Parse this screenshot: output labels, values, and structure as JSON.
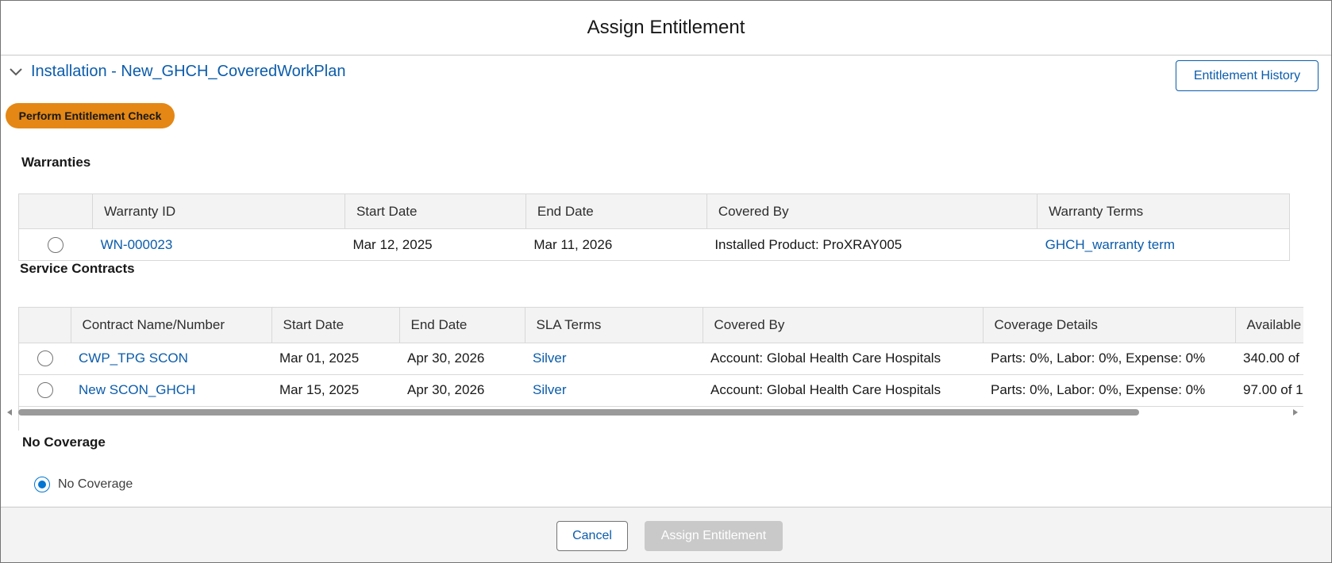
{
  "modal": {
    "title": "Assign Entitlement"
  },
  "installation": {
    "label": "Installation - New_GHCH_CoveredWorkPlan"
  },
  "buttons": {
    "entitlement_history": "Entitlement History",
    "perform_check": "Perform Entitlement Check",
    "cancel": "Cancel",
    "assign": "Assign Entitlement"
  },
  "warranties": {
    "title": "Warranties",
    "columns": [
      "",
      "Warranty ID",
      "Start Date",
      "End Date",
      "Covered By",
      "Warranty Terms"
    ],
    "rows": [
      {
        "id": "WN-000023",
        "start": "Mar 12, 2025",
        "end": "Mar 11, 2026",
        "covered_by": "Installed Product: ProXRAY005",
        "terms": "GHCH_warranty term",
        "selected": false
      }
    ]
  },
  "service_contracts": {
    "title": "Service Contracts",
    "columns": [
      "",
      "Contract Name/Number",
      "Start Date",
      "End Date",
      "SLA Terms",
      "Covered By",
      "Coverage Details",
      "Available"
    ],
    "rows": [
      {
        "name": "CWP_TPG SCON",
        "start": "Mar 01, 2025",
        "end": "Apr 30, 2026",
        "sla": "Silver",
        "covered_by": "Account: Global Health Care Hospitals",
        "coverage": "Parts: 0%, Labor: 0%, Expense: 0%",
        "available": "340.00 of",
        "selected": false
      },
      {
        "name": "New SCON_GHCH",
        "start": "Mar 15, 2025",
        "end": "Apr 30, 2026",
        "sla": "Silver",
        "covered_by": "Account: Global Health Care Hospitals",
        "coverage": "Parts: 0%, Labor: 0%, Expense: 0%",
        "available": "97.00 of 1",
        "selected": false
      }
    ]
  },
  "no_coverage": {
    "title": "No Coverage",
    "option_label": "No Coverage",
    "selected": true
  },
  "colors": {
    "link": "#0b5cab",
    "check_button": "#e48715",
    "radio_selected": "#0176d3",
    "disabled_button": "#c9c9c9"
  },
  "icons": {
    "expand": "chevron-down-icon"
  }
}
